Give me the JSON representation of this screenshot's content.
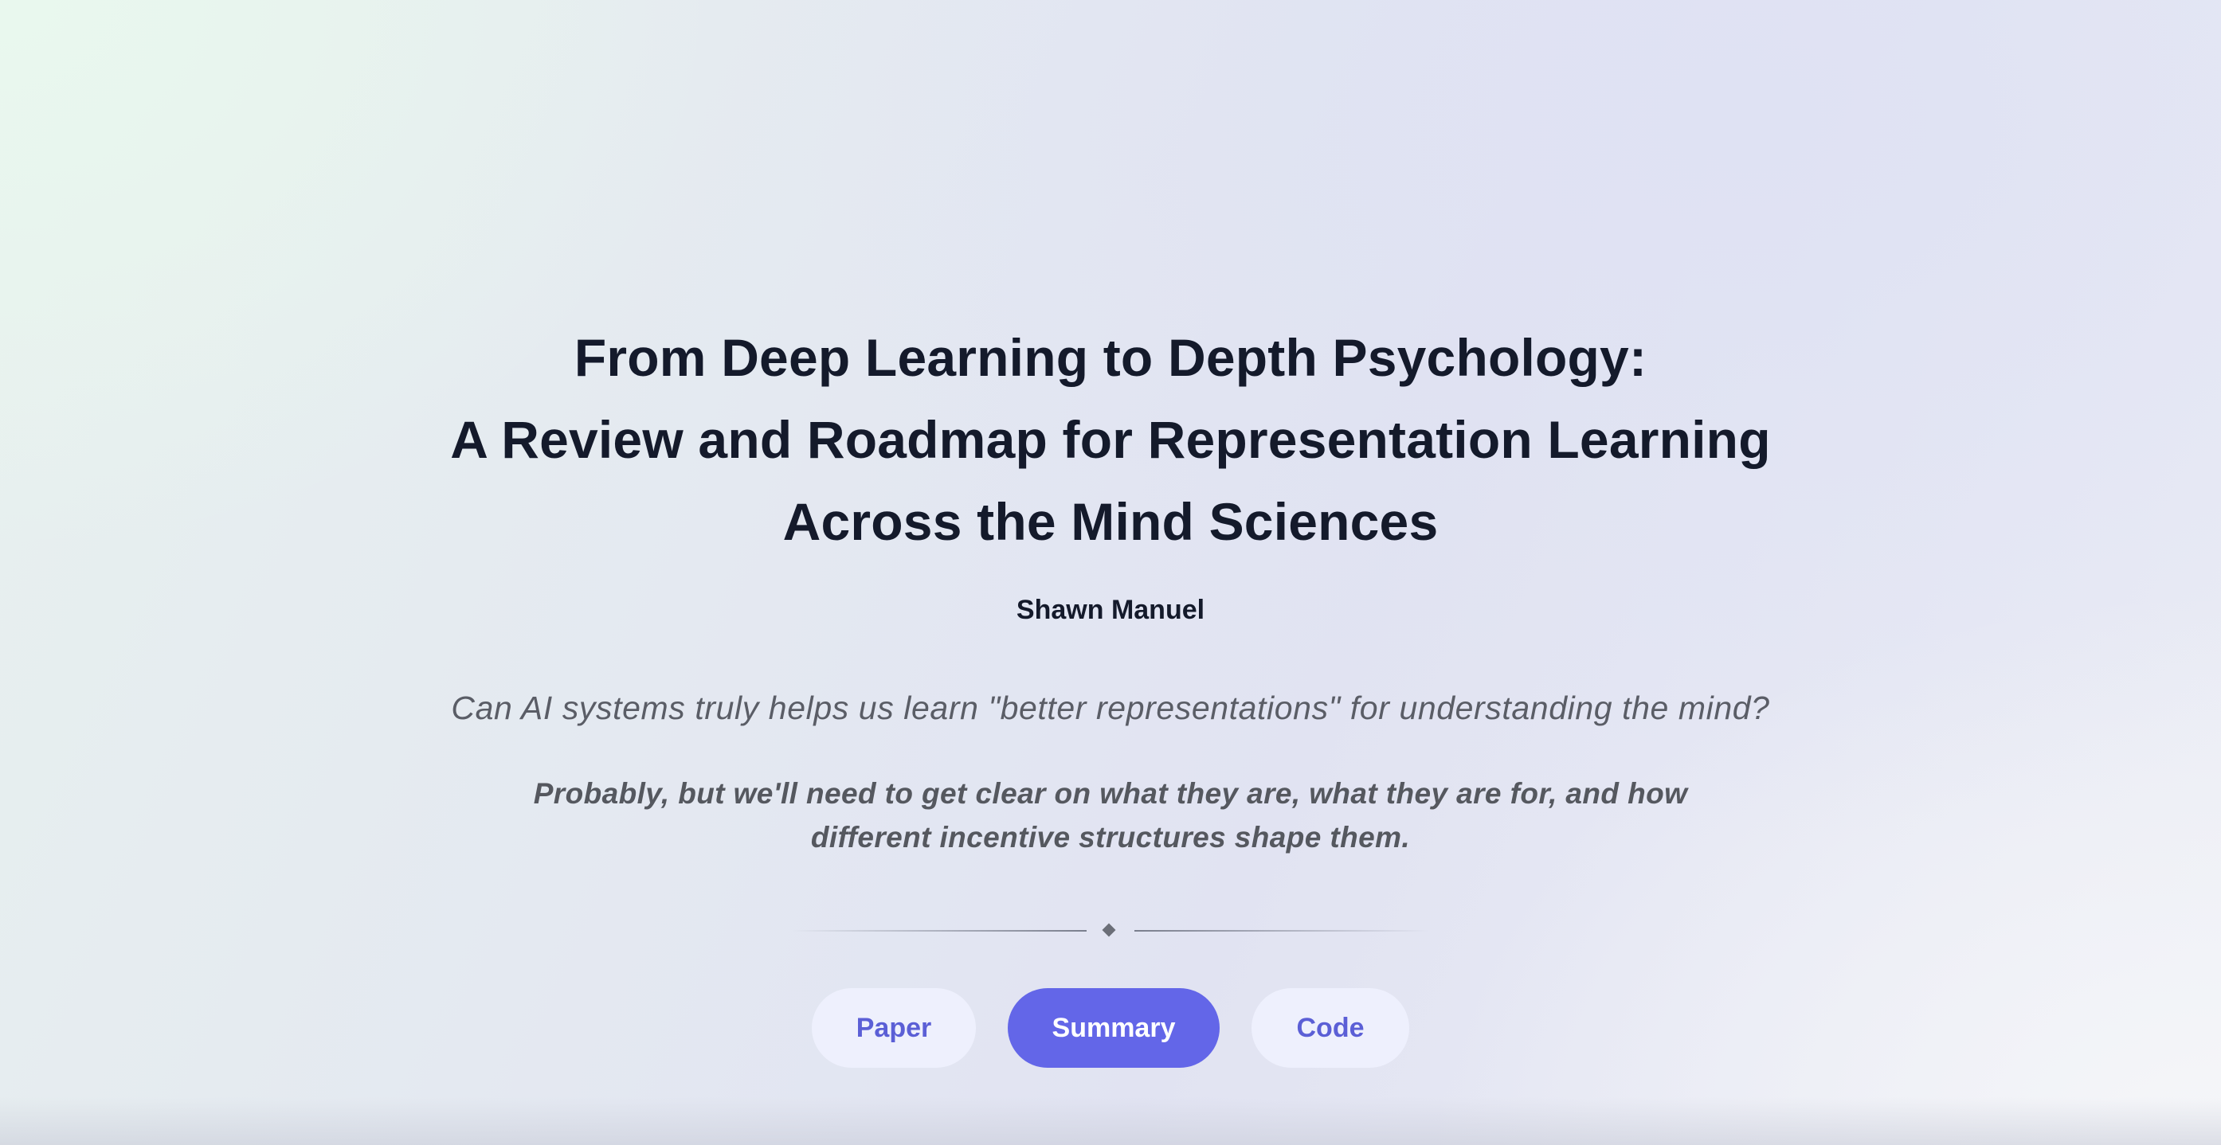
{
  "title": {
    "line1": "From Deep Learning to Depth Psychology:",
    "line2": "A Review and Roadmap for Representation Learning",
    "line3": "Across the Mind Sciences"
  },
  "author": "Shawn Manuel",
  "question": "Can AI systems truly helps us learn \"better representations\" for understanding the mind?",
  "answer": "Probably, but we'll need to get clear on what they are, what they are for, and how different incentive structures shape them.",
  "buttons": {
    "paper": "Paper",
    "summary": "Summary",
    "code": "Code"
  },
  "colors": {
    "title": "#141a2b",
    "muted_text": "#5a5d66",
    "accent": "#6366e8",
    "accent_soft": "#eef0fd",
    "accent_text": "#5b5fd6"
  },
  "icons": {
    "divider": "diamond-icon"
  }
}
